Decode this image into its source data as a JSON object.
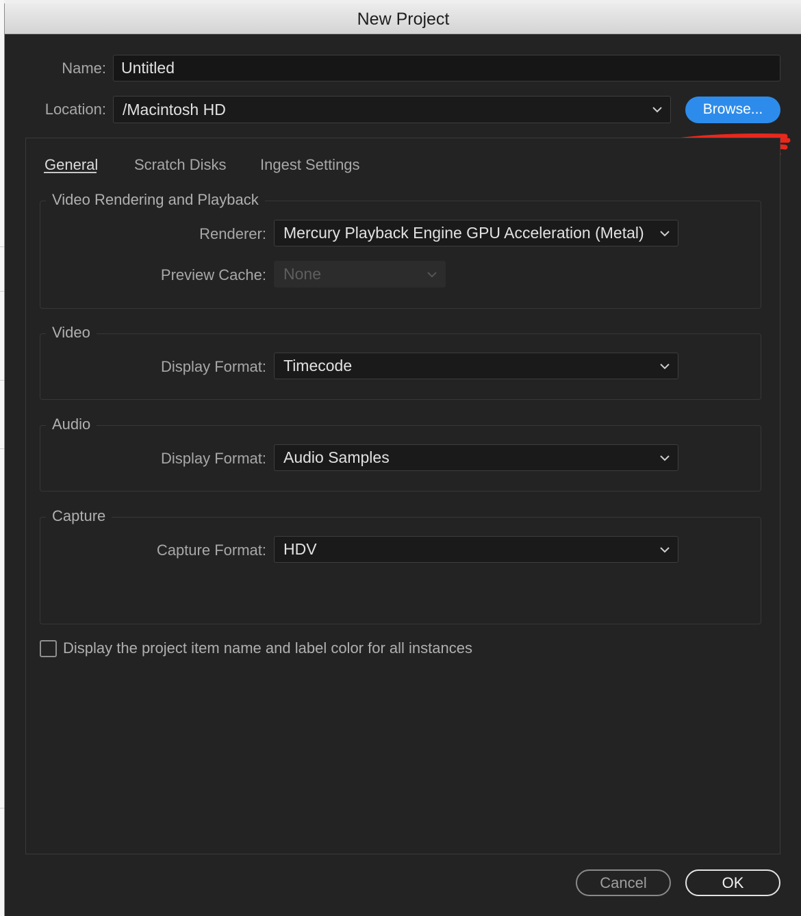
{
  "window": {
    "title": "New Project"
  },
  "form": {
    "name_label": "Name:",
    "name_value": "Untitled",
    "location_label": "Location:",
    "location_value": "/Macintosh HD",
    "browse_label": "Browse..."
  },
  "tabs": [
    {
      "label": "General",
      "active": true
    },
    {
      "label": "Scratch Disks",
      "active": false
    },
    {
      "label": "Ingest Settings",
      "active": false
    }
  ],
  "groups": {
    "rendering": {
      "title": "Video Rendering and Playback",
      "renderer_label": "Renderer:",
      "renderer_value": "Mercury Playback Engine GPU Acceleration (Metal)",
      "preview_label": "Preview Cache:",
      "preview_value": "None"
    },
    "video": {
      "title": "Video",
      "display_label": "Display Format:",
      "display_value": "Timecode"
    },
    "audio": {
      "title": "Audio",
      "display_label": "Display Format:",
      "display_value": "Audio Samples"
    },
    "capture": {
      "title": "Capture",
      "format_label": "Capture Format:",
      "format_value": "HDV"
    }
  },
  "checkbox": {
    "label": "Display the project item name and label color for all instances",
    "checked": false
  },
  "buttons": {
    "cancel": "Cancel",
    "ok": "OK"
  },
  "colors": {
    "accent": "#2d8ceb",
    "background": "#232323",
    "annotation": "#e8281d"
  },
  "icons": [
    "chevron-down-icon"
  ]
}
